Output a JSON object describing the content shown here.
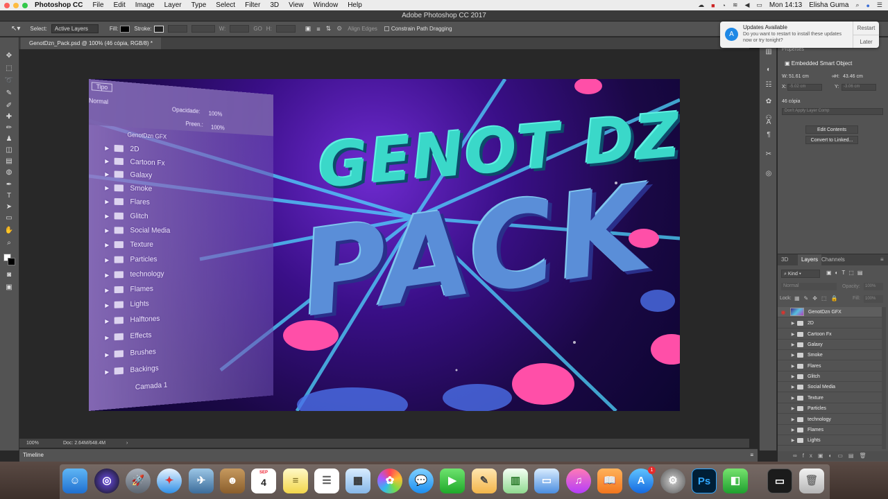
{
  "menubar": {
    "app": "Photoshop CC",
    "items": [
      "File",
      "Edit",
      "Image",
      "Layer",
      "Type",
      "Select",
      "Filter",
      "3D",
      "View",
      "Window",
      "Help"
    ],
    "clock": "Mon 14:13",
    "user": "Elisha Guma"
  },
  "window": {
    "title": "Adobe Photoshop CC 2017"
  },
  "options_bar": {
    "select_label": "Select:",
    "select_value": "Active Layers",
    "fill_label": "Fill:",
    "stroke_label": "Stroke:",
    "w_label": "W:",
    "go_label": "GO",
    "h_label": "H:",
    "align_edges": "Align Edges",
    "constrain": "Constrain Path Dragging"
  },
  "document_tab": {
    "label": "GenotDzn_Pack.psd @ 100% (46 cópia, RGB/8) *"
  },
  "notification": {
    "title": "Updates Available",
    "body": "Do you want to restart to install these updates now or try tonight?",
    "restart": "Restart",
    "later": "Later"
  },
  "properties": {
    "header": "Properties",
    "type": "Embedded Smart Object",
    "w_label": "W:",
    "w_value": "51.61 cm",
    "h_label": "H:",
    "h_value": "43.46 cm",
    "x_label": "X:",
    "x_value": "-5.02 cm",
    "y_label": "Y:",
    "y_value": "-3.06 cm",
    "layer_name": "46 cópia",
    "layer_comp": "Don't Apply Layer Comp",
    "edit_contents": "Edit Contents",
    "convert": "Convert to Linked..."
  },
  "layers_panel": {
    "tabs": [
      "3D",
      "Layers",
      "Channels"
    ],
    "kind_label": "Kind",
    "blend_mode": "Normal",
    "opacity_label": "Opacity:",
    "opacity_value": "100%",
    "lock_label": "Lock:",
    "fill_label": "Fill:",
    "fill_value": "100%",
    "rows": [
      {
        "name": "GenotDzn GFX"
      },
      {
        "name": "2D"
      },
      {
        "name": "Cartoon Fx"
      },
      {
        "name": "Galaxy"
      },
      {
        "name": "Smoke"
      },
      {
        "name": "Flares"
      },
      {
        "name": "Glitch"
      },
      {
        "name": "Social Media"
      },
      {
        "name": "Texture"
      },
      {
        "name": "Particles"
      },
      {
        "name": "technology"
      },
      {
        "name": "Flames"
      },
      {
        "name": "Lights"
      }
    ]
  },
  "artwork": {
    "headline_top": "GENOT DZN",
    "headline_bottom": "PACK",
    "panel_tipo": "Tipo",
    "panel_normal": "Normal",
    "panel_opacity_label": "Opacidade:",
    "panel_opacity_value": "100%",
    "panel_fill_label": "Preen.:",
    "panel_fill_value": "100%",
    "panel_rows": [
      "GenotDzn GFX",
      "2D",
      "Cartoon Fx",
      "Galaxy",
      "Smoke",
      "Flares",
      "Glitch",
      "Social Media",
      "Texture",
      "Particles",
      "technology",
      "Flames",
      "Lights",
      "Halftones",
      "Effects",
      "Brushes",
      "Backings",
      "Camada 1"
    ]
  },
  "status_bar": {
    "zoom": "100%",
    "doc": "Doc: 2.64M/648.4M"
  },
  "timeline": {
    "label": "Timeline"
  },
  "dock": {
    "calendar_month": "SEP",
    "calendar_day": "4",
    "app_store_badge": "1",
    "ps_label": "Ps"
  },
  "colors": {
    "accent": "#1e88e5",
    "eye": "#e0312b",
    "ps_blue": "#31a8ff"
  }
}
